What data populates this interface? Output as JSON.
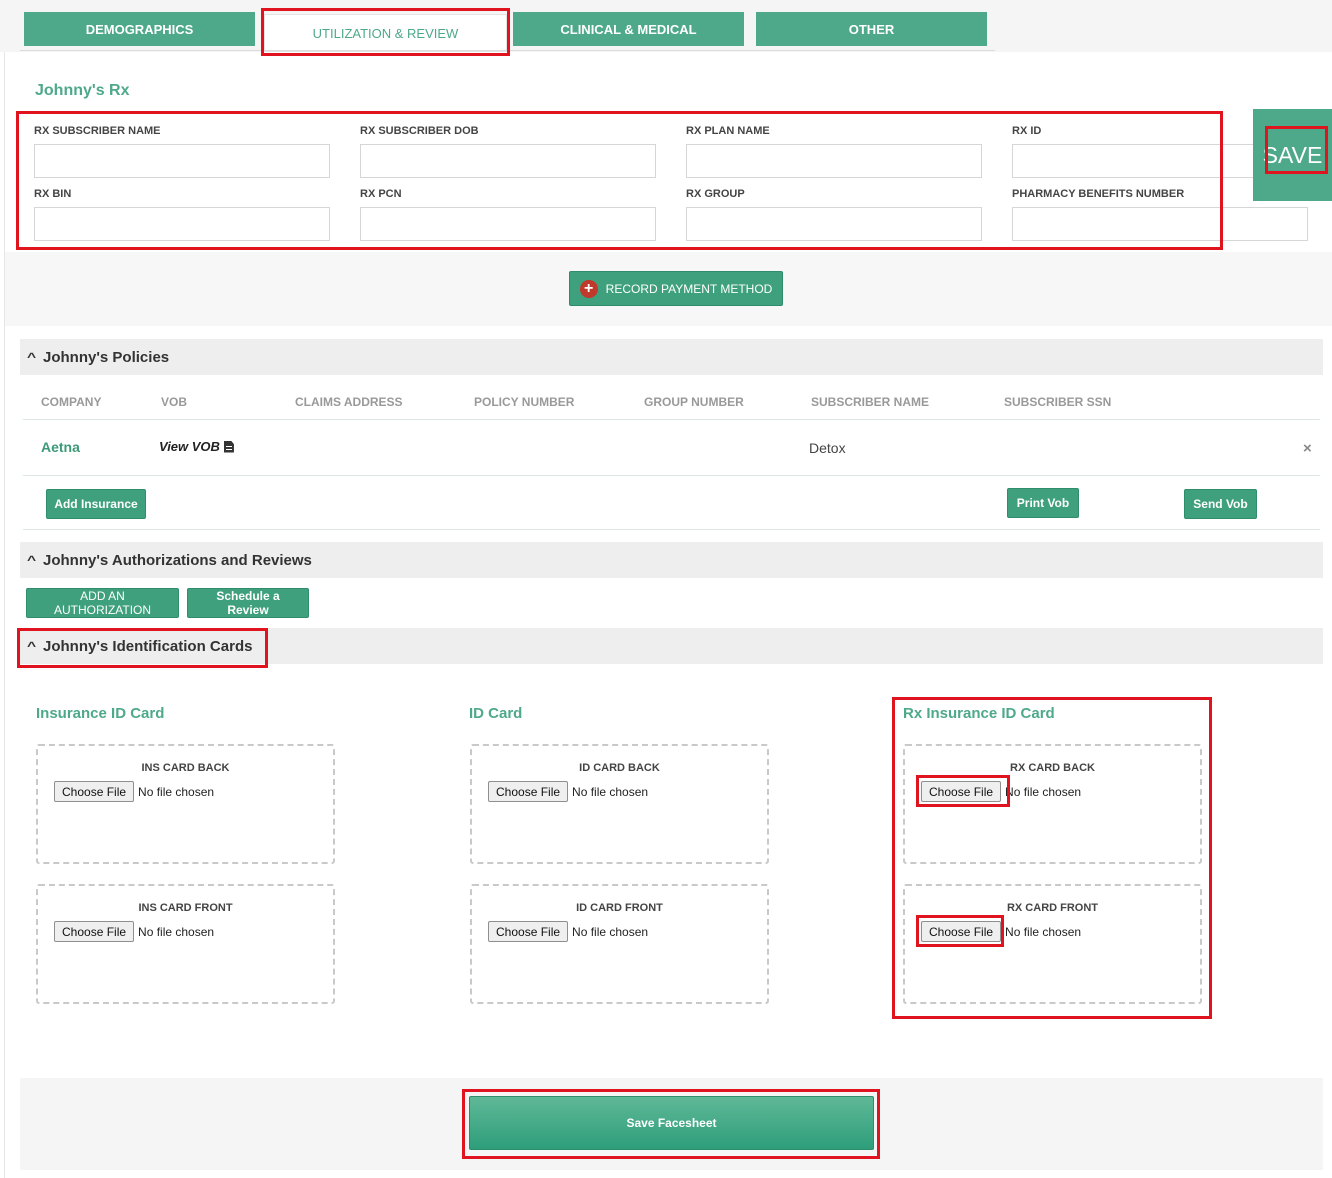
{
  "tabs": [
    {
      "label": "DEMOGRAPHICS",
      "active": false
    },
    {
      "label": "UTILIZATION & REVIEW",
      "active": true
    },
    {
      "label": "CLINICAL & MEDICAL",
      "active": false
    },
    {
      "label": "OTHER",
      "active": false
    }
  ],
  "rx": {
    "title": "Johnny's Rx",
    "fields": [
      {
        "label": "RX SUBSCRIBER NAME",
        "value": ""
      },
      {
        "label": "RX SUBSCRIBER DOB",
        "value": ""
      },
      {
        "label": "RX PLAN NAME",
        "value": ""
      },
      {
        "label": "RX ID",
        "value": ""
      },
      {
        "label": "RX BIN",
        "value": ""
      },
      {
        "label": "RX PCN",
        "value": ""
      },
      {
        "label": "RX GROUP",
        "value": ""
      },
      {
        "label": "PHARMACY BENEFITS NUMBER",
        "value": ""
      }
    ],
    "save_label": "SAVE",
    "record_payment_label": "RECORD PAYMENT METHOD"
  },
  "policies": {
    "title": "Johnny's Policies",
    "columns": [
      "COMPANY",
      "VOB",
      "CLAIMS ADDRESS",
      "POLICY NUMBER",
      "GROUP NUMBER",
      "SUBSCRIBER NAME",
      "SUBSCRIBER SSN"
    ],
    "rows": [
      {
        "company": "Aetna",
        "vob": "View VOB",
        "claims_address": "",
        "policy_number": "",
        "group_number": "",
        "subscriber_name": "Detox",
        "subscriber_ssn": "",
        "remove": "×"
      }
    ],
    "add_insurance_label": "Add Insurance",
    "print_vob_label": "Print Vob",
    "send_vob_label": "Send Vob"
  },
  "authorizations": {
    "title": "Johnny's Authorizations and Reviews",
    "add_auth_label": "ADD AN AUTHORIZATION",
    "schedule_review_label": "Schedule a Review"
  },
  "id_cards": {
    "title": "Johnny's Identification Cards",
    "choose_file_label": "Choose File",
    "no_file_text": "No file chosen",
    "groups": [
      {
        "title": "Insurance ID Card",
        "back_label": "INS CARD BACK",
        "front_label": "INS CARD FRONT"
      },
      {
        "title": "ID Card",
        "back_label": "ID CARD BACK",
        "front_label": "ID CARD FRONT"
      },
      {
        "title": "Rx Insurance ID Card",
        "back_label": "RX CARD BACK",
        "front_label": "RX CARD FRONT"
      }
    ]
  },
  "footer": {
    "save_facesheet_label": "Save Facesheet"
  },
  "colors": {
    "accent": "#4ea98a",
    "highlight": "#e0141e"
  },
  "icons": {
    "collapse": "chevron-up-icon",
    "payment": "plus-circle-icon",
    "vob": "document-icon",
    "remove": "close-icon"
  }
}
